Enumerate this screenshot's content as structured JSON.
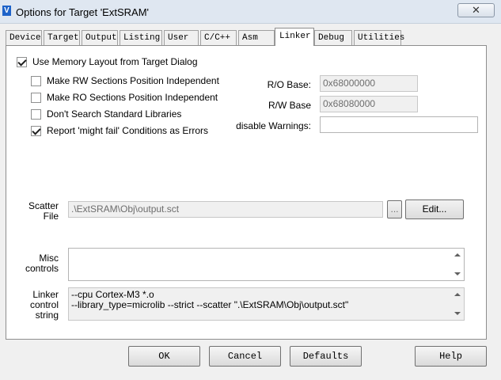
{
  "window": {
    "title": "Options for Target 'ExtSRAM'",
    "app_icon_glyph": "V",
    "close_glyph": "✕"
  },
  "tabs": [
    {
      "label": "Device",
      "active": false
    },
    {
      "label": "Target",
      "active": false
    },
    {
      "label": "Output",
      "active": false
    },
    {
      "label": "Listing",
      "active": false
    },
    {
      "label": "User",
      "active": false
    },
    {
      "label": "C/C++",
      "active": false
    },
    {
      "label": "Asm",
      "active": false
    },
    {
      "label": "Linker",
      "active": true
    },
    {
      "label": "Debug",
      "active": false
    },
    {
      "label": "Utilities",
      "active": false
    }
  ],
  "linker": {
    "use_memory_layout": {
      "label": "Use Memory Layout from Target Dialog",
      "checked": true
    },
    "options": [
      {
        "label": "Make RW Sections Position Independent",
        "checked": false
      },
      {
        "label": "Make RO Sections Position Independent",
        "checked": false
      },
      {
        "label": "Don't Search Standard Libraries",
        "checked": false
      },
      {
        "label": "Report 'might fail' Conditions as Errors",
        "checked": true
      }
    ],
    "ro_base": {
      "label": "R/O Base:",
      "value": "0x68000000"
    },
    "rw_base": {
      "label": "R/W Base",
      "value": "0x68080000"
    },
    "disable_warnings": {
      "label": "disable Warnings:",
      "value": ""
    },
    "scatter_file": {
      "label_line1": "Scatter",
      "label_line2": "File",
      "value": ".\\ExtSRAM\\Obj\\output.sct",
      "browse_label": "...",
      "edit_label": "Edit..."
    },
    "misc_controls": {
      "label_line1": "Misc",
      "label_line2": "controls",
      "value": ""
    },
    "linker_control": {
      "label_line1": "Linker",
      "label_line2": "control",
      "label_line3": "string",
      "line1": "--cpu Cortex-M3 *.o",
      "line2": "--library_type=microlib --strict --scatter \".\\ExtSRAM\\Obj\\output.sct\""
    }
  },
  "buttons": {
    "ok": "OK",
    "cancel": "Cancel",
    "defaults": "Defaults",
    "help": "Help"
  }
}
